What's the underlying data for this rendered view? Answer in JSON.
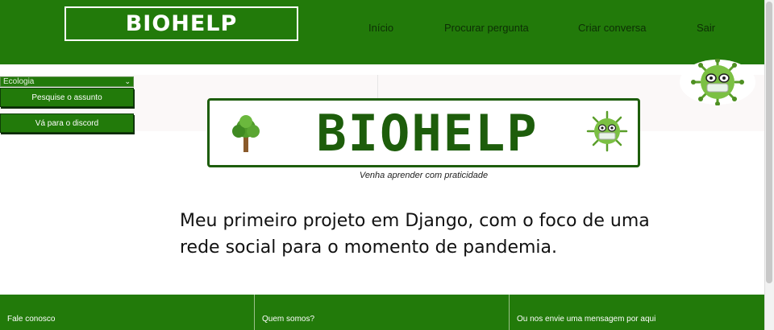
{
  "header": {
    "logo": "BIOHELP",
    "nav": [
      {
        "label": "Início"
      },
      {
        "label": "Procurar pergunta"
      },
      {
        "label": "Criar conversa"
      },
      {
        "label": "Sair"
      }
    ]
  },
  "sidebar": {
    "topic_select": {
      "value": "Ecologia"
    },
    "search_button": "Pesquise o assunto",
    "discord_button": "Vá para o discord"
  },
  "banner": {
    "title": "BIOHELP",
    "tagline": "Venha aprender com praticidade"
  },
  "description": {
    "line1": "Meu primeiro projeto em Django, com o foco de uma",
    "line2": "rede social para o momento de pandemia."
  },
  "footer": {
    "contact": "Fale conosco",
    "about": "Quem somos?",
    "message": "Ou nos envie uma mensagem por aqui"
  },
  "colors": {
    "brand_green": "#227a0a",
    "dark_green": "#1d5d0b",
    "virus_green": "#7bc043"
  },
  "icons": {
    "tree": "tree-icon",
    "virus": "virus-mascot-icon"
  }
}
